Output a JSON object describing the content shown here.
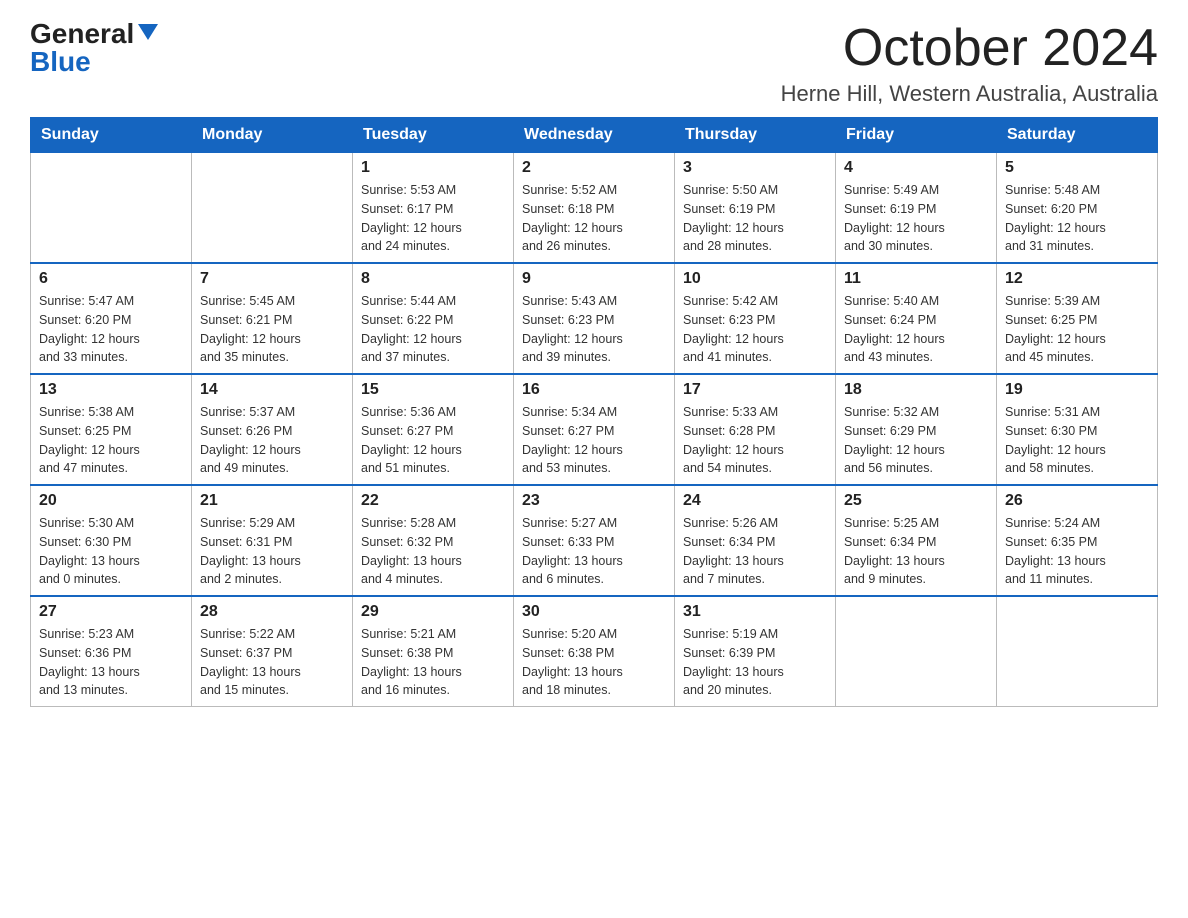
{
  "header": {
    "logo_general": "General",
    "logo_blue": "Blue",
    "month_title": "October 2024",
    "location": "Herne Hill, Western Australia, Australia"
  },
  "days_of_week": [
    "Sunday",
    "Monday",
    "Tuesday",
    "Wednesday",
    "Thursday",
    "Friday",
    "Saturday"
  ],
  "weeks": [
    [
      {
        "day": "",
        "info": ""
      },
      {
        "day": "",
        "info": ""
      },
      {
        "day": "1",
        "info": "Sunrise: 5:53 AM\nSunset: 6:17 PM\nDaylight: 12 hours\nand 24 minutes."
      },
      {
        "day": "2",
        "info": "Sunrise: 5:52 AM\nSunset: 6:18 PM\nDaylight: 12 hours\nand 26 minutes."
      },
      {
        "day": "3",
        "info": "Sunrise: 5:50 AM\nSunset: 6:19 PM\nDaylight: 12 hours\nand 28 minutes."
      },
      {
        "day": "4",
        "info": "Sunrise: 5:49 AM\nSunset: 6:19 PM\nDaylight: 12 hours\nand 30 minutes."
      },
      {
        "day": "5",
        "info": "Sunrise: 5:48 AM\nSunset: 6:20 PM\nDaylight: 12 hours\nand 31 minutes."
      }
    ],
    [
      {
        "day": "6",
        "info": "Sunrise: 5:47 AM\nSunset: 6:20 PM\nDaylight: 12 hours\nand 33 minutes."
      },
      {
        "day": "7",
        "info": "Sunrise: 5:45 AM\nSunset: 6:21 PM\nDaylight: 12 hours\nand 35 minutes."
      },
      {
        "day": "8",
        "info": "Sunrise: 5:44 AM\nSunset: 6:22 PM\nDaylight: 12 hours\nand 37 minutes."
      },
      {
        "day": "9",
        "info": "Sunrise: 5:43 AM\nSunset: 6:23 PM\nDaylight: 12 hours\nand 39 minutes."
      },
      {
        "day": "10",
        "info": "Sunrise: 5:42 AM\nSunset: 6:23 PM\nDaylight: 12 hours\nand 41 minutes."
      },
      {
        "day": "11",
        "info": "Sunrise: 5:40 AM\nSunset: 6:24 PM\nDaylight: 12 hours\nand 43 minutes."
      },
      {
        "day": "12",
        "info": "Sunrise: 5:39 AM\nSunset: 6:25 PM\nDaylight: 12 hours\nand 45 minutes."
      }
    ],
    [
      {
        "day": "13",
        "info": "Sunrise: 5:38 AM\nSunset: 6:25 PM\nDaylight: 12 hours\nand 47 minutes."
      },
      {
        "day": "14",
        "info": "Sunrise: 5:37 AM\nSunset: 6:26 PM\nDaylight: 12 hours\nand 49 minutes."
      },
      {
        "day": "15",
        "info": "Sunrise: 5:36 AM\nSunset: 6:27 PM\nDaylight: 12 hours\nand 51 minutes."
      },
      {
        "day": "16",
        "info": "Sunrise: 5:34 AM\nSunset: 6:27 PM\nDaylight: 12 hours\nand 53 minutes."
      },
      {
        "day": "17",
        "info": "Sunrise: 5:33 AM\nSunset: 6:28 PM\nDaylight: 12 hours\nand 54 minutes."
      },
      {
        "day": "18",
        "info": "Sunrise: 5:32 AM\nSunset: 6:29 PM\nDaylight: 12 hours\nand 56 minutes."
      },
      {
        "day": "19",
        "info": "Sunrise: 5:31 AM\nSunset: 6:30 PM\nDaylight: 12 hours\nand 58 minutes."
      }
    ],
    [
      {
        "day": "20",
        "info": "Sunrise: 5:30 AM\nSunset: 6:30 PM\nDaylight: 13 hours\nand 0 minutes."
      },
      {
        "day": "21",
        "info": "Sunrise: 5:29 AM\nSunset: 6:31 PM\nDaylight: 13 hours\nand 2 minutes."
      },
      {
        "day": "22",
        "info": "Sunrise: 5:28 AM\nSunset: 6:32 PM\nDaylight: 13 hours\nand 4 minutes."
      },
      {
        "day": "23",
        "info": "Sunrise: 5:27 AM\nSunset: 6:33 PM\nDaylight: 13 hours\nand 6 minutes."
      },
      {
        "day": "24",
        "info": "Sunrise: 5:26 AM\nSunset: 6:34 PM\nDaylight: 13 hours\nand 7 minutes."
      },
      {
        "day": "25",
        "info": "Sunrise: 5:25 AM\nSunset: 6:34 PM\nDaylight: 13 hours\nand 9 minutes."
      },
      {
        "day": "26",
        "info": "Sunrise: 5:24 AM\nSunset: 6:35 PM\nDaylight: 13 hours\nand 11 minutes."
      }
    ],
    [
      {
        "day": "27",
        "info": "Sunrise: 5:23 AM\nSunset: 6:36 PM\nDaylight: 13 hours\nand 13 minutes."
      },
      {
        "day": "28",
        "info": "Sunrise: 5:22 AM\nSunset: 6:37 PM\nDaylight: 13 hours\nand 15 minutes."
      },
      {
        "day": "29",
        "info": "Sunrise: 5:21 AM\nSunset: 6:38 PM\nDaylight: 13 hours\nand 16 minutes."
      },
      {
        "day": "30",
        "info": "Sunrise: 5:20 AM\nSunset: 6:38 PM\nDaylight: 13 hours\nand 18 minutes."
      },
      {
        "day": "31",
        "info": "Sunrise: 5:19 AM\nSunset: 6:39 PM\nDaylight: 13 hours\nand 20 minutes."
      },
      {
        "day": "",
        "info": ""
      },
      {
        "day": "",
        "info": ""
      }
    ]
  ]
}
